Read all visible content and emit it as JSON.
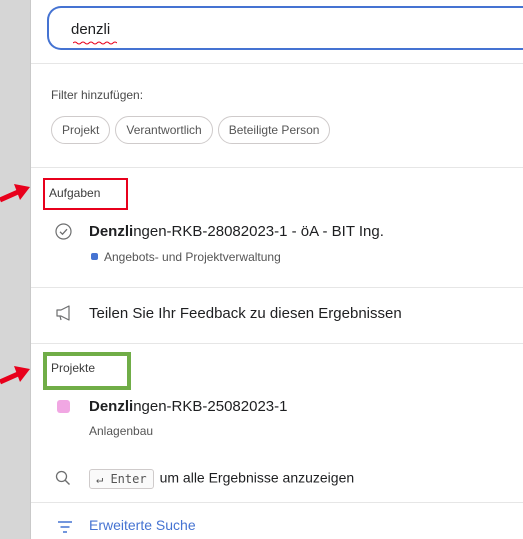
{
  "search": {
    "value": "denzli"
  },
  "filters": {
    "title": "Filter hinzufügen:",
    "chips": [
      "Projekt",
      "Verantwortlich",
      "Beteiligte Person"
    ]
  },
  "tasks": {
    "label": "Aufgaben",
    "item": {
      "match": "Denzli",
      "rest": "ngen-RKB-28082023-1 - öA - BIT Ing.",
      "project": "Angebots- und Projektverwaltung",
      "project_color": "#4573d2"
    }
  },
  "feedback": {
    "label": "Teilen Sie Ihr Feedback zu diesen Ergebnissen"
  },
  "projects": {
    "label": "Projekte",
    "item": {
      "match": "Denzli",
      "rest": "ngen-RKB-25082023-1",
      "team": "Anlagenbau",
      "color": "#f1a7e3"
    }
  },
  "show_all": {
    "key": "↵ Enter",
    "text": "um alle Ergebnisse anzuzeigen"
  },
  "advanced": {
    "label": "Erweiterte Suche"
  },
  "annotations": {
    "red": "#e8001c",
    "green": "#70ad47"
  }
}
